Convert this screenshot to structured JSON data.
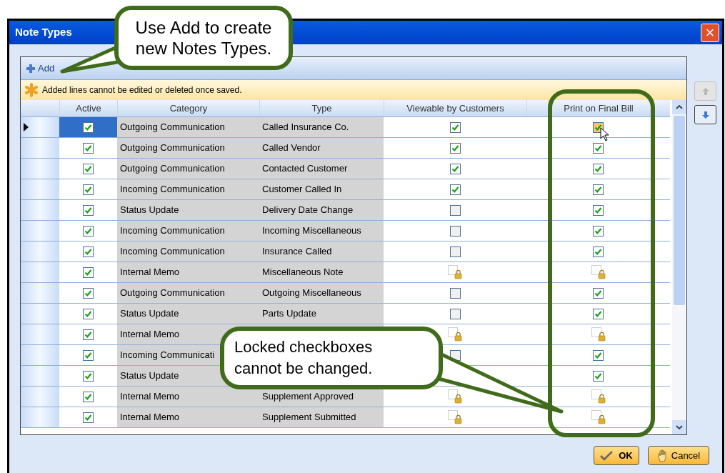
{
  "window": {
    "title": "Note Types",
    "close": "×"
  },
  "toolbar": {
    "add": "Add"
  },
  "notice": "Added lines cannot be edited or deleted once saved.",
  "table": {
    "columns": [
      "Active",
      "Category",
      "Type",
      "Viewable by Customers",
      "Print on Final Bill"
    ],
    "rows": [
      {
        "selected": true,
        "active": true,
        "category": "Outgoing Communication",
        "type": "Called Insurance Co.",
        "viewable": {
          "checked": true,
          "locked": false
        },
        "print": {
          "checked": true,
          "locked": false,
          "hovered": true
        }
      },
      {
        "selected": false,
        "active": true,
        "category": "Outgoing Communication",
        "type": "Called Vendor",
        "viewable": {
          "checked": true,
          "locked": false
        },
        "print": {
          "checked": true,
          "locked": false
        }
      },
      {
        "selected": false,
        "active": true,
        "category": "Outgoing Communication",
        "type": "Contacted Customer",
        "viewable": {
          "checked": true,
          "locked": false
        },
        "print": {
          "checked": true,
          "locked": false
        }
      },
      {
        "selected": false,
        "active": true,
        "category": "Incoming Communication",
        "type": "Customer Called In",
        "viewable": {
          "checked": true,
          "locked": false
        },
        "print": {
          "checked": true,
          "locked": false
        }
      },
      {
        "selected": false,
        "active": true,
        "category": "Status Update",
        "type": "Delivery Date Change",
        "viewable": {
          "checked": false,
          "locked": false
        },
        "print": {
          "checked": true,
          "locked": false
        }
      },
      {
        "selected": false,
        "active": true,
        "category": "Incoming Communication",
        "type": "Incoming Miscellaneous",
        "viewable": {
          "checked": false,
          "locked": false
        },
        "print": {
          "checked": true,
          "locked": false
        }
      },
      {
        "selected": false,
        "active": true,
        "category": "Incoming Communication",
        "type": "Insurance Called",
        "viewable": {
          "checked": false,
          "locked": false
        },
        "print": {
          "checked": true,
          "locked": false
        }
      },
      {
        "selected": false,
        "active": true,
        "category": "Internal Memo",
        "type": "Miscellaneous Note",
        "viewable": {
          "locked": true
        },
        "print": {
          "locked": true
        }
      },
      {
        "selected": false,
        "active": true,
        "category": "Outgoing Communication",
        "type": "Outgoing Miscellaneous",
        "viewable": {
          "checked": false,
          "locked": false
        },
        "print": {
          "checked": true,
          "locked": false
        }
      },
      {
        "selected": false,
        "active": true,
        "category": "Status Update",
        "type": "Parts Update",
        "viewable": {
          "checked": false,
          "locked": false
        },
        "print": {
          "checked": true,
          "locked": false
        }
      },
      {
        "selected": false,
        "active": true,
        "category": "Internal Memo",
        "viewable": {
          "locked": true
        },
        "print": {
          "locked": true
        }
      },
      {
        "selected": false,
        "active": true,
        "category": "Incoming Communicati",
        "viewable": {
          "checked": false,
          "locked": false
        },
        "print": {
          "checked": true,
          "locked": false
        }
      },
      {
        "selected": false,
        "active": true,
        "category": "Status Update",
        "print": {
          "checked": true,
          "locked": false
        }
      },
      {
        "selected": false,
        "active": true,
        "category": "Internal Memo",
        "type": "Supplement Approved",
        "viewable": {
          "locked": true
        },
        "print": {
          "locked": true
        }
      },
      {
        "selected": false,
        "active": true,
        "category": "Internal Memo",
        "type": "Supplement Submitted",
        "viewable": {
          "locked": true
        },
        "print": {
          "locked": true
        }
      }
    ]
  },
  "buttons": {
    "ok": "OK",
    "cancel": "Cancel"
  },
  "callouts": [
    "Use Add to create new Notes Types.",
    "Locked checkboxes cannot be changed."
  ]
}
